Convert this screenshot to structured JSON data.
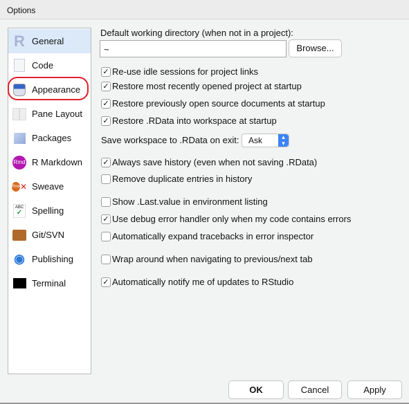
{
  "window": {
    "title": "Options"
  },
  "sidebar": {
    "items": [
      {
        "label": "General",
        "icon": "r-logo-icon",
        "selected": true
      },
      {
        "label": "Code",
        "icon": "code-document-icon"
      },
      {
        "label": "Appearance",
        "icon": "paint-bucket-icon",
        "highlighted": true
      },
      {
        "label": "Pane Layout",
        "icon": "pane-layout-icon"
      },
      {
        "label": "Packages",
        "icon": "package-cube-icon"
      },
      {
        "label": "R Markdown",
        "icon": "rmd-icon",
        "icon_text": "Rmd"
      },
      {
        "label": "Sweave",
        "icon": "sweave-icon",
        "icon_text": "Rnw"
      },
      {
        "label": "Spelling",
        "icon": "spellcheck-icon",
        "icon_text": "ABC"
      },
      {
        "label": "Git/SVN",
        "icon": "git-box-icon"
      },
      {
        "label": "Publishing",
        "icon": "publishing-icon"
      },
      {
        "label": "Terminal",
        "icon": "terminal-icon"
      }
    ]
  },
  "general": {
    "wd_label": "Default working directory (when not in a project):",
    "wd_value": "~",
    "browse": "Browse...",
    "save_ws_label": "Save workspace to .RData on exit:",
    "save_ws_value": "Ask",
    "options": [
      {
        "label": "Re-use idle sessions for project links",
        "checked": true
      },
      {
        "label": "Restore most recently opened project at startup",
        "checked": true
      },
      {
        "label": "Restore previously open source documents at startup",
        "checked": true
      },
      {
        "label": "Restore .RData into workspace at startup",
        "checked": true
      },
      {
        "label": "Always save history (even when not saving .RData)",
        "checked": true
      },
      {
        "label": "Remove duplicate entries in history",
        "checked": false
      },
      {
        "label": "Show .Last.value in environment listing",
        "checked": false
      },
      {
        "label": "Use debug error handler only when my code contains errors",
        "checked": true
      },
      {
        "label": "Automatically expand tracebacks in error inspector",
        "checked": false
      },
      {
        "label": "Wrap around when navigating to previous/next tab",
        "checked": false
      },
      {
        "label": "Automatically notify me of updates to RStudio",
        "checked": true
      }
    ]
  },
  "footer": {
    "ok": "OK",
    "cancel": "Cancel",
    "apply": "Apply"
  },
  "colors": {
    "selection": "#dbe9f9",
    "highlight_circle": "#e0202a",
    "select_accent": "#3b84f6"
  }
}
